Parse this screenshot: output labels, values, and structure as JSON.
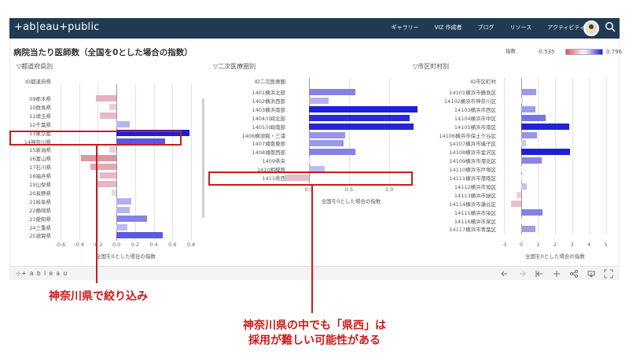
{
  "nav": {
    "logo": "+ab|eau+public",
    "items": [
      "ギャラリー",
      "VIZ 作成者",
      "ブログ",
      "リソース",
      "アクティビティ"
    ]
  },
  "dashboard": {
    "title": "病院当たり医師数（全国を0とした場合の指数）",
    "legend": {
      "label": "指数",
      "min": "-0.535",
      "max": "0.796"
    },
    "colors": {
      "positive": "#1f1fd6",
      "negative": "#d9545e",
      "nav": "#1f3a52",
      "annotation": "#cc1a1a"
    }
  },
  "footer": {
    "logo": "⊹+ a b l e a u"
  },
  "annotations": {
    "box1_text": "神奈川県で絞り込み",
    "box2_text": "神奈川県の中でも「県西」は\n採用が難しい可能性がある"
  },
  "chart_data": [
    {
      "type": "bar",
      "section": "▽都道府県別",
      "column_header": "ID都道府県",
      "xlabel": "全国を0とした場合の指数",
      "xlim": [
        -0.65,
        0.85
      ],
      "xticks": [
        "-0.6",
        "-0.4",
        "-0.2",
        "0.0",
        "0.2",
        "0.4",
        "0.6",
        "0.8"
      ],
      "tick_values": [
        -0.6,
        -0.4,
        -0.2,
        0.0,
        0.2,
        0.4,
        0.6,
        0.8
      ],
      "categories": [
        "09栃木県",
        "10群馬県",
        "11埼玉県",
        "12千葉県",
        "13東京都",
        "14神奈川県",
        "15新潟県",
        "16富山県",
        "17石川県",
        "18福井県",
        "19山梨県",
        "20長野県",
        "21岐阜県",
        "22静岡県",
        "23愛知県",
        "24三重県",
        "25滋賀県"
      ],
      "values": [
        -0.22,
        -0.08,
        -0.18,
        0.14,
        0.78,
        0.52,
        -0.08,
        -0.38,
        -0.28,
        -0.18,
        -0.2,
        -0.05,
        0.16,
        0.14,
        0.33,
        0.12,
        0.5
      ]
    },
    {
      "type": "bar",
      "section": "▽二次医療圏別",
      "column_header": "ID二次医療圏",
      "xlabel": "全国を0とした場合の指数",
      "xlim": [
        -0.25,
        1.3
      ],
      "xticks": [
        "0.0",
        "0.5",
        "1.0"
      ],
      "tick_values": [
        0.0,
        0.5,
        1.0
      ],
      "categories": [
        "1401横浜北部",
        "1402横浜西部",
        "1403横浜南部",
        "1404川崎北部",
        "1405川崎南部",
        "1406横須賀・三浦",
        "1407湘南東部",
        "1408湘南西部",
        "1409県央",
        "1410相模原",
        "1411県西"
      ],
      "values": [
        0.58,
        0.25,
        1.35,
        1.25,
        1.3,
        0.45,
        0.43,
        0.58,
        0.02,
        0.2,
        -0.3
      ]
    },
    {
      "type": "bar",
      "section": "▽市区町村別",
      "column_header": "ID市区町村",
      "xlabel": "全国を0とした場合の指数",
      "xlim": [
        -1.3,
        5.3
      ],
      "xticks": [
        "-1",
        "0",
        "1",
        "2",
        "3",
        "4",
        "5"
      ],
      "tick_values": [
        -1,
        0,
        1,
        2,
        3,
        4,
        5
      ],
      "categories": [
        "14101横浜市鶴見区",
        "14102横浜市神奈川区",
        "14103横浜市西区",
        "14104横浜市中区",
        "14105横浜市南区",
        "14106横浜市保土ケ谷区",
        "14107横浜市磯子区",
        "14108横浜市金沢区",
        "14109横浜市港北区",
        "14110横浜市戸塚区",
        "14111横浜市港南区",
        "14112横浜市旭区",
        "14113横浜市緑区",
        "14114横浜市瀬谷区",
        "14115横浜市栄区",
        "14116横浜市泉区",
        "14117横浜市青葉区"
      ],
      "values": [
        0.9,
        0.1,
        0.85,
        1.45,
        2.85,
        0.95,
        0.3,
        2.9,
        1.2,
        0.0,
        0.0,
        0.35,
        -0.3,
        -0.6,
        1.25,
        0.05,
        0.85
      ]
    }
  ]
}
